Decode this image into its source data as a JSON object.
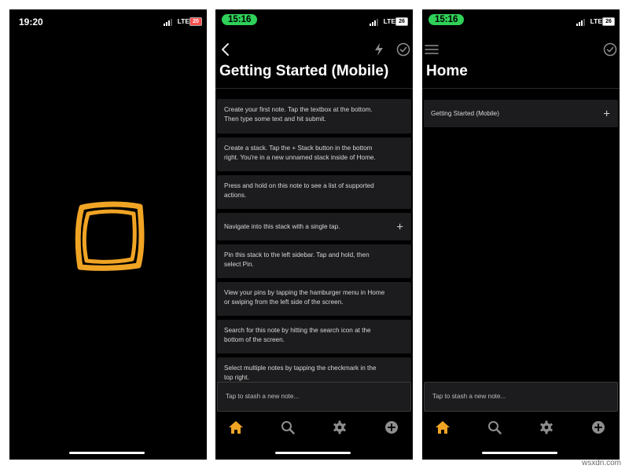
{
  "colors": {
    "accent": "#f0a424",
    "pill_green": "#2fd158",
    "background": "#000000",
    "card": "#1c1c1e"
  },
  "screen1": {
    "status": {
      "time": "19:20",
      "network": "LTE",
      "battery": "20"
    },
    "logo": "app-logo-square-icon"
  },
  "screen2": {
    "status": {
      "time": "15:16",
      "network": "LTE",
      "battery": "26"
    },
    "title": "Getting Started (Mobile)",
    "notes": [
      {
        "text": "Create your first note. Tap the textbox at the bottom. Then type some text and hit submit."
      },
      {
        "text": "Create a stack. Tap the + Stack button in the bottom right. You're in a new unnamed stack inside of Home."
      },
      {
        "text": "Press and hold on this note to see a list of supported actions."
      },
      {
        "text": "Navigate into this stack with a single tap.",
        "plus": "+"
      },
      {
        "text": "Pin this stack to the left sidebar. Tap and hold, then select Pin."
      },
      {
        "text": "View your pins by tapping the hamburger menu in Home or swiping from the left side of the screen."
      },
      {
        "text": "Search for this note by hitting the search icon at the bottom of the screen."
      },
      {
        "text": "Select multiple notes by tapping the checkmark in the top right."
      }
    ],
    "input_placeholder": "Tap to stash a new note..."
  },
  "screen3": {
    "status": {
      "time": "15:16",
      "network": "LTE",
      "battery": "26"
    },
    "title": "Home",
    "stacks": [
      {
        "label": "Getting Started (Mobile)",
        "plus": "+"
      }
    ],
    "input_placeholder": "Tap to stash a new note..."
  },
  "tabs": [
    "home-icon",
    "search-icon",
    "gear-icon",
    "add-circle-icon"
  ],
  "watermark": "wsxdn.com"
}
